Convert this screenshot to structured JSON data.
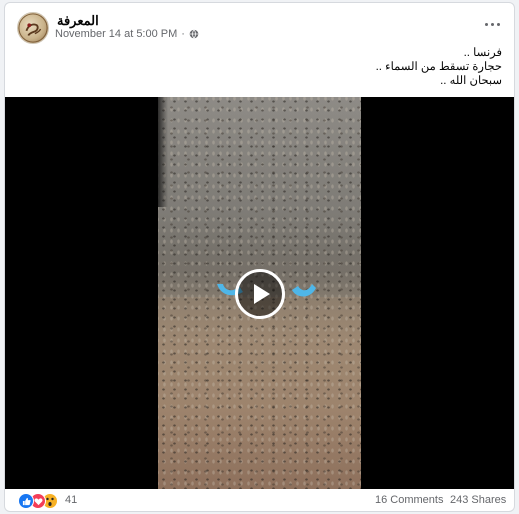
{
  "post": {
    "page_name": "المعرفة",
    "timestamp": "November 14 at 5:00 PM",
    "separator": "·",
    "privacy_icon": "globe-icon",
    "caption_lines": [
      "فرنسا ..",
      "حجارة تسقط من السماء ..",
      "سبحان الله .."
    ]
  },
  "video": {
    "play_icon": "play-icon"
  },
  "footer": {
    "reaction_icons": [
      "like-icon",
      "love-icon",
      "wow-icon"
    ],
    "reaction_count": "41",
    "comments": "16 Comments",
    "shares": "243 Shares"
  },
  "colors": {
    "like": "#1877f2",
    "love": "#f33e58",
    "wow": "#f7b125",
    "secondary_text": "#65676b"
  }
}
